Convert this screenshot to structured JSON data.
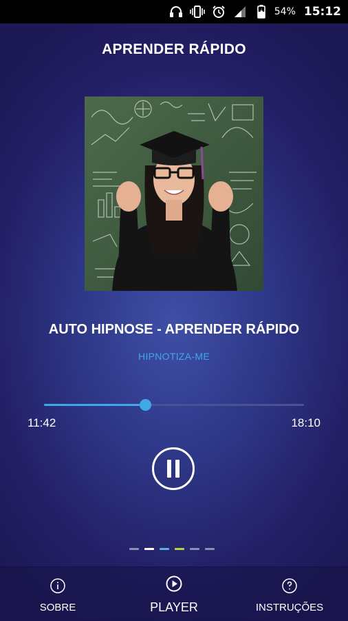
{
  "status_bar": {
    "battery_percent": "54%",
    "clock": "15:12",
    "icons": [
      "headphones-icon",
      "vibrate-icon",
      "alarm-icon",
      "signal-icon",
      "battery-icon"
    ]
  },
  "header": {
    "title": "APRENDER RÁPIDO"
  },
  "now_playing": {
    "artwork": "graduate-woman-chalkboard-image",
    "track_title": "AUTO HIPNOSE - APRENDER RÁPIDO",
    "artist": "HIPNOTIZA-ME",
    "elapsed": "11:42",
    "total": "18:10",
    "progress": 0.39
  },
  "controls": {
    "play_state_icon": "pause-icon"
  },
  "page_indicator": {
    "count": 6,
    "colors": [
      "#8a8db8",
      "#ffffff",
      "#5ab0e0",
      "#b5d63a",
      "#8a8db8",
      "#8a8db8"
    ]
  },
  "bottom_nav": {
    "items": [
      {
        "label": "SOBRE",
        "icon": "info-icon"
      },
      {
        "label": "PLAYER",
        "icon": "play-icon"
      },
      {
        "label": "INSTRUÇÕES",
        "icon": "help-icon"
      }
    ]
  },
  "colors": {
    "accent": "#3fa9e8",
    "background": "#2e3787"
  }
}
